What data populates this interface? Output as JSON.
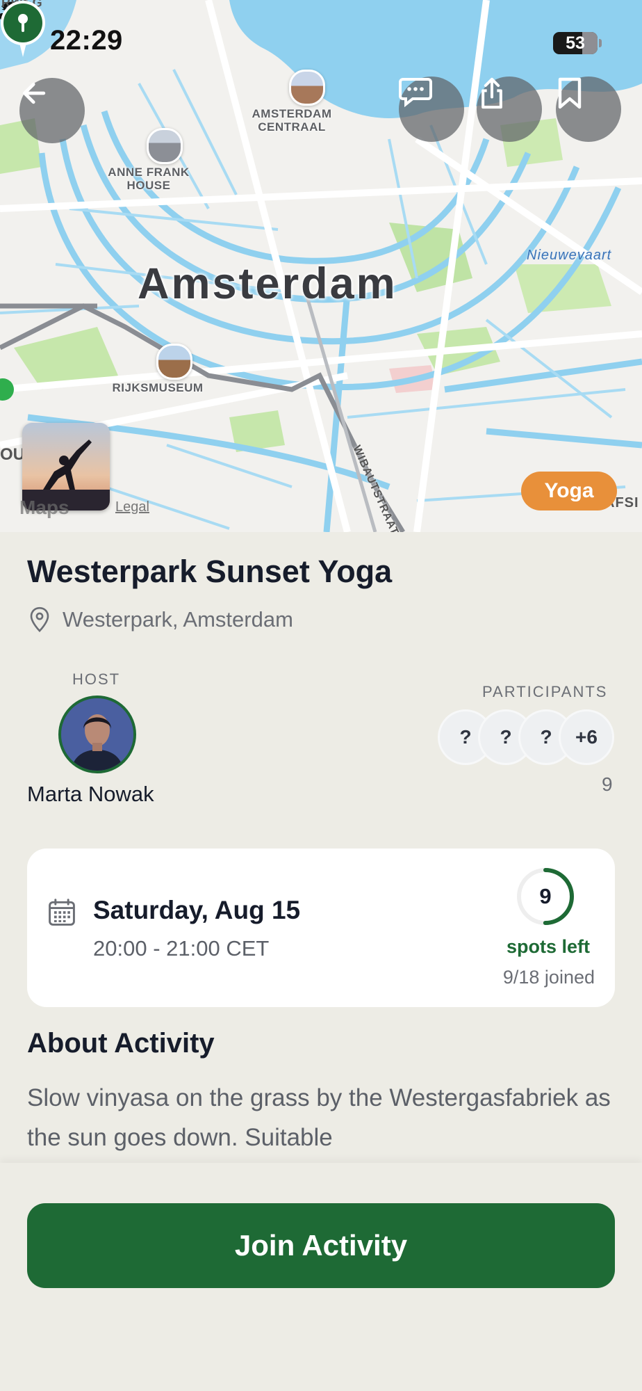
{
  "status_bar": {
    "time": "22:29",
    "battery": "53"
  },
  "map": {
    "city_label": "Amsterdam",
    "water_label": "Nieuwevaart",
    "street_label": "WIBAUTSTRAAT",
    "poi": [
      {
        "id": "anne-frank",
        "label_line1": "ANNE FRANK",
        "label_line2": "HOUSE"
      },
      {
        "id": "centraal",
        "label_line1": "AMSTERDAM",
        "label_line2": "CENTRAAL"
      },
      {
        "id": "rijksmuseum",
        "label_line1": "RIJKSMUSEUM",
        "label_line2": ""
      }
    ],
    "legal": "Legal",
    "maps_attribution": "Maps",
    "edge_fragments": {
      "top_left": "RWEG",
      "left": "OU",
      "right": "AFSI"
    },
    "category_tag": "Yoga"
  },
  "activity": {
    "title": "Westerpark Sunset Yoga",
    "location": "Westerpark, Amsterdam",
    "host_label": "HOST",
    "host_name": "Marta Nowak",
    "participants_label": "PARTICIPANTS",
    "participants": [
      "?",
      "?",
      "?",
      "+6"
    ],
    "participant_count": "9",
    "date": "Saturday, Aug 15",
    "time_range": "20:00 - 21:00 CET",
    "spots_left_number": "9",
    "spots_left_label": "spots left",
    "joined": "9/18 joined",
    "spots_fraction_filled": 0.5,
    "about_heading": "About Activity",
    "about_text": "Slow vinyasa on the grass by the Westergasfabriek as the sun goes down. Suitable"
  },
  "actions": {
    "join_label": "Join Activity"
  },
  "colors": {
    "primary_green": "#1e6a35",
    "tag_orange": "#e8903a",
    "background": "#edece5"
  },
  "icons": {
    "back": "arrow-left-icon",
    "chat": "chat-bubble-icon",
    "share": "share-icon",
    "bookmark": "bookmark-icon",
    "location": "location-pin-icon",
    "calendar": "calendar-icon"
  }
}
